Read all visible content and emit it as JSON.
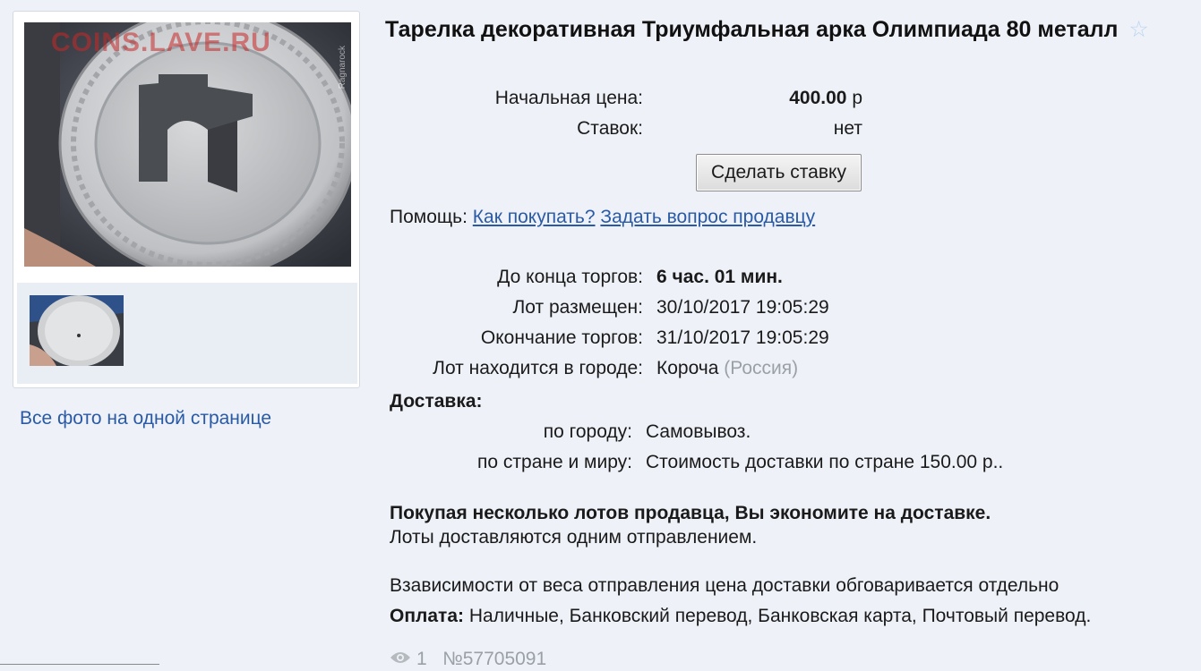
{
  "watermark": "COINS.LAVE.RU",
  "photo_side_watermark": "Ragnarock",
  "gallery": {
    "all_photos_link": "Все фото на одной странице"
  },
  "lot": {
    "title": "Тарелка декоративная Триумфальная арка Олимпиада 80 металл",
    "start_price_label": "Начальная цена:",
    "start_price_value": "400.00",
    "currency": "р",
    "bids_label": "Ставок:",
    "bids_value": "нет",
    "bid_button": "Сделать ставку",
    "help_label": "Помощь:",
    "help_how_to_buy": "Как покупать?",
    "help_ask_seller": "Задать вопрос продавцу",
    "time_left_label": "До конца торгов:",
    "time_left_value": "6 час. 01 мин.",
    "posted_label": "Лот размещен:",
    "posted_value": "30/10/2017 19:05:29",
    "ends_label": "Окончание торгов:",
    "ends_value": "31/10/2017 19:05:29",
    "city_label": "Лот находится в городе:",
    "city_value": "Короча",
    "country_value": "(Россия)"
  },
  "delivery": {
    "heading": "Доставка:",
    "city_label": "по городу:",
    "city_value": "Самовывоз.",
    "world_label": "по стране и миру:",
    "world_value": "Стоимость доставки по стране 150.00 р..",
    "multi_lot_bold": "Покупая несколько лотов продавца, Вы экономите на доставке.",
    "multi_lot_note": "Лоты доставляются одним отправлением.",
    "weight_note": "Взависимости от веса отправления цена доставки обговаривается отдельно"
  },
  "payment": {
    "label": "Оплата:",
    "value": "Наличные, Банковский перевод, Банковская карта, Почтовый перевод."
  },
  "footer": {
    "views": "1",
    "lot_number": "№57705091"
  }
}
